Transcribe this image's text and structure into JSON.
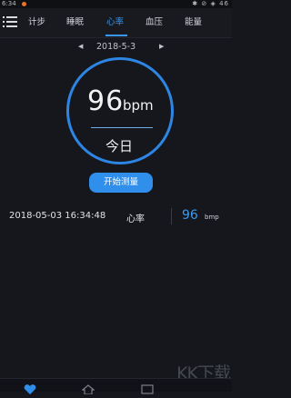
{
  "status": {
    "time": "6:34",
    "right_indicators": "✱ ⊘ ◈ 46"
  },
  "tabs": [
    {
      "label": "计步"
    },
    {
      "label": "睡眠"
    },
    {
      "label": "心率",
      "active": true
    },
    {
      "label": "血压"
    },
    {
      "label": "能量"
    }
  ],
  "date_nav": {
    "date": "2018-5-3",
    "prev_arrow": "◀",
    "next_arrow": "▶"
  },
  "heart": {
    "value": "96",
    "unit": "bpm",
    "label": "今日"
  },
  "actions": {
    "start_label": "开始测量"
  },
  "record": {
    "datetime": "2018-05-03 16:34:48",
    "type": "心率",
    "value": "96",
    "unit": "bmp"
  },
  "watermark": "KK下载",
  "colors": {
    "accent": "#2f8fea",
    "background": "#15171d"
  }
}
